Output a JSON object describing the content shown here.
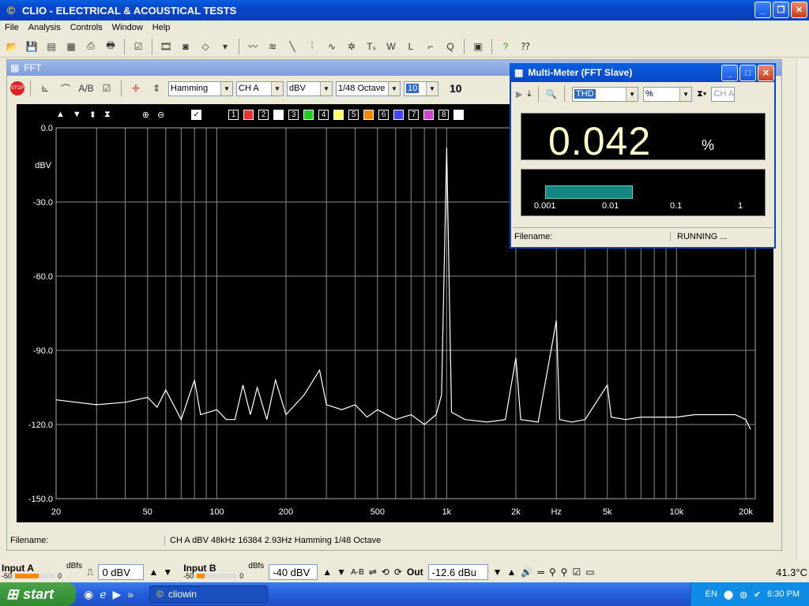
{
  "window": {
    "title": "CLIO - ELECTRICAL & ACOUSTICAL TESTS"
  },
  "menu": [
    "File",
    "Analysis",
    "Controls",
    "Window",
    "Help"
  ],
  "fft": {
    "title": "FFT",
    "window_fn": "Hamming",
    "channel": "CH A",
    "units": "dBV",
    "smoothing": "1/48 Octave",
    "avg_field": "10",
    "avg_display": "10",
    "stop_label": "STOP",
    "trace_boxes": [
      "1",
      "2",
      "3",
      "4",
      "5",
      "6",
      "7",
      "8"
    ],
    "trace_colors": [
      "#e33",
      "#fff",
      "#2c2",
      "#ff6",
      "#f80",
      "#44f",
      "#c4c",
      "#fff"
    ],
    "status_filename": "Filename:",
    "status_info": "CH A   dBV   48kHz   16384   2.93Hz   Hamming   1/48 Octave"
  },
  "chart_data": {
    "type": "line",
    "xscale": "log",
    "xlim": [
      20,
      22000
    ],
    "ylim": [
      -150,
      0
    ],
    "ylabel": "dBV",
    "y_ticks": [
      "0.0",
      "-30.0",
      "-60.0",
      "-90.0",
      "-120.0",
      "-150.0"
    ],
    "x_ticks": [
      "20",
      "50",
      "100",
      "200",
      "500",
      "1k",
      "2k",
      "Hz",
      "5k",
      "10k",
      "20k"
    ],
    "series": [
      {
        "color": "#ffffff",
        "points": [
          [
            20,
            -110
          ],
          [
            30,
            -112
          ],
          [
            40,
            -111
          ],
          [
            50,
            -109
          ],
          [
            55,
            -113
          ],
          [
            60,
            -106
          ],
          [
            70,
            -118
          ],
          [
            80,
            -102
          ],
          [
            85,
            -116
          ],
          [
            100,
            -114
          ],
          [
            110,
            -118
          ],
          [
            120,
            -118
          ],
          [
            130,
            -104
          ],
          [
            140,
            -116
          ],
          [
            150,
            -105
          ],
          [
            165,
            -118
          ],
          [
            180,
            -102
          ],
          [
            200,
            -116
          ],
          [
            240,
            -108
          ],
          [
            280,
            -98
          ],
          [
            300,
            -112
          ],
          [
            350,
            -114
          ],
          [
            400,
            -112
          ],
          [
            450,
            -117
          ],
          [
            500,
            -114
          ],
          [
            600,
            -118
          ],
          [
            700,
            -116
          ],
          [
            800,
            -120
          ],
          [
            900,
            -116
          ],
          [
            950,
            -108
          ],
          [
            1000,
            -8
          ],
          [
            1050,
            -115
          ],
          [
            1200,
            -118
          ],
          [
            1500,
            -119
          ],
          [
            1800,
            -118
          ],
          [
            2000,
            -93
          ],
          [
            2100,
            -118
          ],
          [
            2500,
            -119
          ],
          [
            3000,
            -78
          ],
          [
            3100,
            -118
          ],
          [
            3500,
            -119
          ],
          [
            4000,
            -118
          ],
          [
            5000,
            -104
          ],
          [
            5200,
            -117
          ],
          [
            6000,
            -118
          ],
          [
            7000,
            -117
          ],
          [
            8000,
            -117
          ],
          [
            10000,
            -117
          ],
          [
            12000,
            -116
          ],
          [
            15000,
            -116
          ],
          [
            18000,
            -116
          ],
          [
            20000,
            -118
          ],
          [
            21000,
            -122
          ]
        ]
      }
    ]
  },
  "multimeter": {
    "title": "Multi-Meter (FFT Slave)",
    "measure": "THD",
    "unit_sel": "%",
    "channel": "CH A",
    "value": "0.042",
    "unit": "%",
    "bar_fraction": 0.37,
    "bar_ticks": [
      "0.001",
      "0.01",
      "0.1",
      "1"
    ],
    "filename": "Filename:",
    "state": "RUNNING ..."
  },
  "bottom": {
    "input_a": "Input A",
    "input_a_scale": "-50",
    "input_a_unit": "dBfs",
    "input_a_zero": "0",
    "input_a_value": "0 dBV",
    "input_b": "Input B",
    "input_b_scale": "-50",
    "input_b_unit": "dBfs",
    "input_b_zero": "0",
    "input_b_value": "-40 dBV",
    "out_label": "Out",
    "out_value": "-12.6 dBu",
    "ab_label": "A-B",
    "temperature": "41.3°C"
  },
  "taskbar": {
    "start": "start",
    "task": "cliowin",
    "lang": "EN",
    "clock": "6:30 PM"
  }
}
